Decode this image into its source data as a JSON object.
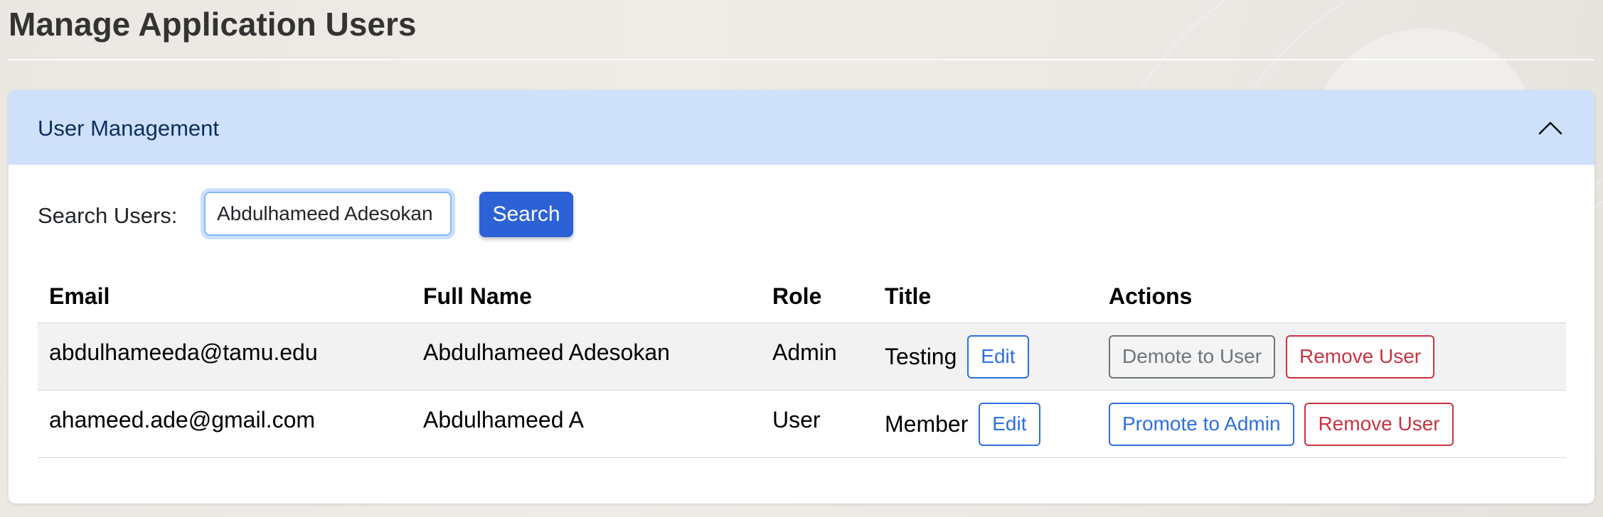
{
  "page": {
    "title": "Manage Application Users"
  },
  "panel": {
    "title": "User Management",
    "collapse_icon": "chevron-up-icon"
  },
  "search": {
    "label": "Search Users:",
    "value": "Abdulhameed Adesokan",
    "button_label": "Search"
  },
  "table": {
    "headers": {
      "email": "Email",
      "full_name": "Full Name",
      "role": "Role",
      "title": "Title",
      "actions": "Actions"
    },
    "rows": [
      {
        "email": "abdulhameeda@tamu.edu",
        "full_name": "Abdulhameed Adesokan",
        "role": "Admin",
        "title": "Testing",
        "edit_label": "Edit",
        "role_action_label": "Demote to User",
        "remove_label": "Remove User"
      },
      {
        "email": "ahameed.ade@gmail.com",
        "full_name": "Abdulhameed A",
        "role": "User",
        "title": "Member",
        "edit_label": "Edit",
        "role_action_label": "Promote to Admin",
        "remove_label": "Remove User"
      }
    ]
  },
  "colors": {
    "header_bg": "#cfe0fb",
    "primary": "#2d62d6",
    "danger": "#c83442",
    "secondary": "#6c757d"
  }
}
